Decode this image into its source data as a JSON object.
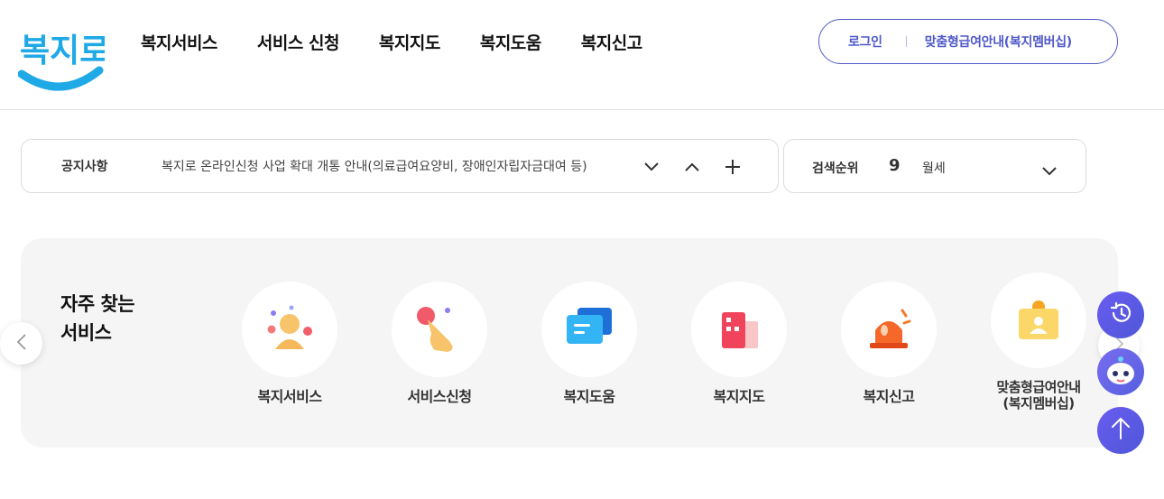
{
  "header": {
    "logo_text": "복지로",
    "nav": [
      "복지서비스",
      "서비스 신청",
      "복지지도",
      "복지도움",
      "복지신고"
    ],
    "util": {
      "login": "로그인",
      "membership": "맞춤형급여안내(복지멤버십)"
    }
  },
  "notice": {
    "title": "공지사항",
    "text": "복지로 온라인신청 사업 확대 개통 안내(의료급여요양비, 장애인자립자금대여 등)"
  },
  "search_rank": {
    "title": "검색순위",
    "rank": "9",
    "keyword": "월세"
  },
  "quick": {
    "title_line1": "자주 찾는",
    "title_line2": "서비스",
    "items": [
      {
        "label": "복지서비스",
        "icon": "people-icon"
      },
      {
        "label": "서비스신청",
        "icon": "hand-tap-icon"
      },
      {
        "label": "복지도움",
        "icon": "chat-icon"
      },
      {
        "label": "복지지도",
        "icon": "building-icon"
      },
      {
        "label": "복지신고",
        "icon": "siren-icon"
      },
      {
        "label_line1": "맞춤형급여안내",
        "label_line2": "(복지멤버십)",
        "icon": "id-card-icon"
      }
    ]
  },
  "colors": {
    "brand": "#4e58c8",
    "logo": "#1fa9e6",
    "panel": "#f5f5f5"
  }
}
